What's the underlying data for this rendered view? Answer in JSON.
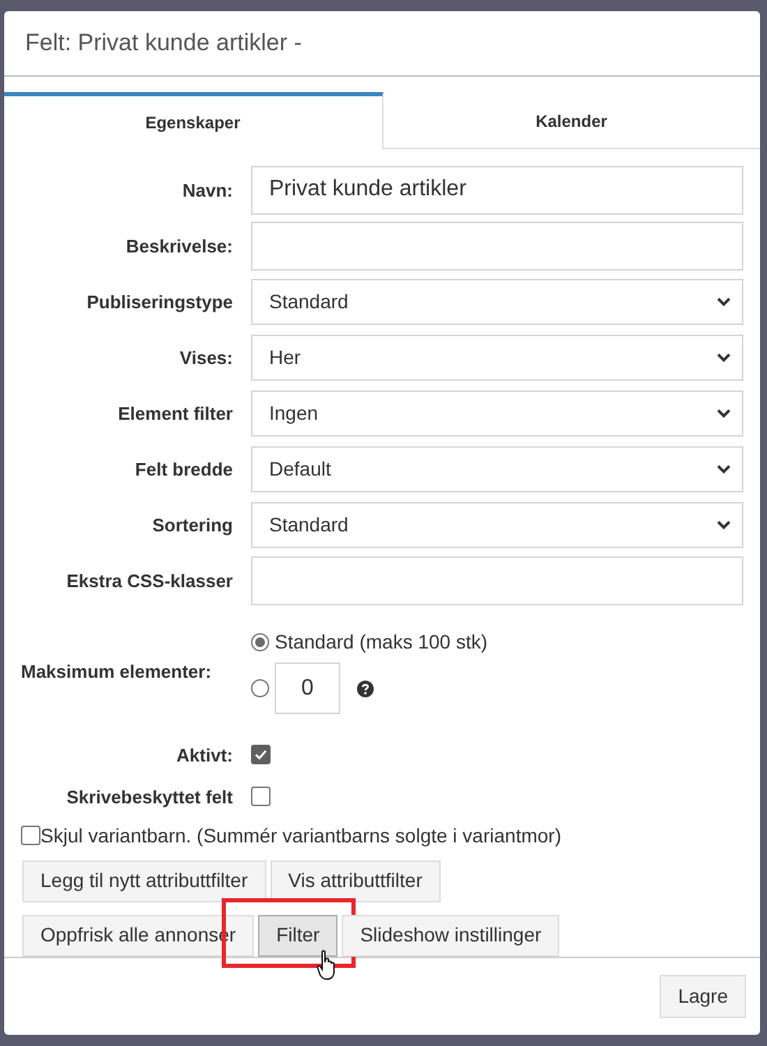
{
  "dialog": {
    "title": "Felt: Privat kunde artikler -"
  },
  "tabs": [
    {
      "label": "Egenskaper",
      "selected": true
    },
    {
      "label": "Kalender",
      "selected": false
    }
  ],
  "form": [
    {
      "kind": "text",
      "label": "Navn:",
      "value": "Privat kunde artikler"
    },
    {
      "kind": "text",
      "label": "Beskrivelse:"
    },
    {
      "kind": "select",
      "label": "Publiseringstype",
      "value": "Standard"
    },
    {
      "kind": "select",
      "label": "Vises:",
      "value": "Her"
    },
    {
      "kind": "select",
      "label": "Element filter",
      "value": "Ingen"
    },
    {
      "kind": "select",
      "label": "Felt bredde",
      "value": "Default"
    },
    {
      "kind": "select",
      "label": "Sortering",
      "value": "Standard"
    },
    {
      "kind": "text",
      "label": "Ekstra CSS-klasser"
    },
    {
      "kind": "max",
      "label": "Maksimum elementer:",
      "options": [
        {
          "label": "Standard (maks 100 stk)",
          "selected": true
        },
        {
          "value": "0",
          "selected": false
        }
      ]
    },
    {
      "kind": "checkbox",
      "label": "Aktivt:",
      "checked": true
    },
    {
      "kind": "checkbox",
      "label": "Skrivebeskyttet felt",
      "checked": false
    }
  ],
  "hide_variants": {
    "label": "Skjul variantbarn. (Summér variantbarns solgte i variantmor)",
    "checked": false
  },
  "button_rows": [
    [
      {
        "label": "Legg til nytt attributtfilter",
        "highlighted": false
      },
      {
        "label": "Vis attributtfilter",
        "highlighted": false
      }
    ],
    [
      {
        "label": "Oppfrisk alle annonser",
        "highlighted": false
      },
      {
        "label": "Filter",
        "highlighted": true
      },
      {
        "label": "Slideshow instillinger",
        "highlighted": false
      }
    ]
  ],
  "footer": {
    "save": "Lagre"
  }
}
